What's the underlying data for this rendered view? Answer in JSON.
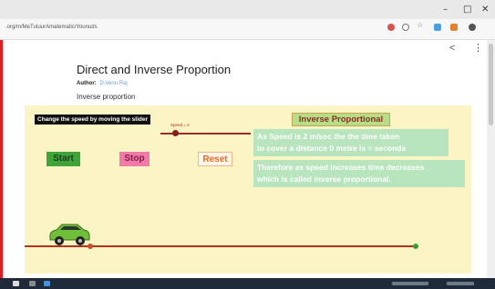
{
  "browser": {
    "url": ".org/m/MeTuIuurAmatematic/Younuds",
    "window_controls": {
      "minimize": "–",
      "maximize": "□",
      "close": "✕"
    }
  },
  "page": {
    "title": "Direct and Inverse Proportion",
    "author_label": "Author:",
    "author_name": "D.Venu Raj",
    "subtitle": "Inverse proportion",
    "share_icon": "share-icon",
    "menu_icon": "kebab-menu-icon"
  },
  "applet": {
    "hint": "Change the speed by moving the slider",
    "slider_label": "Speed = 2",
    "buttons": {
      "start": "Start",
      "stop": "Stop",
      "reset": "Reset"
    },
    "heading": "Inverse Proportional",
    "message1": [
      "As Speed is 2 m/sec the the time taken",
      "to cover a distance 0 metre is = seconds"
    ],
    "message2": [
      "Therefore as speed increases time decreases",
      "which is called inverse proportional."
    ],
    "colors": {
      "applet_bg": "#fbf4c4",
      "start": "#3fa53a",
      "stop": "#f07aa8",
      "road": "#b5321f",
      "car": "#6fbf3a"
    }
  },
  "taskbar": {
    "icons": [
      "windows-start-icon",
      "search-icon",
      "task-view-icon",
      "chrome-icon"
    ]
  }
}
